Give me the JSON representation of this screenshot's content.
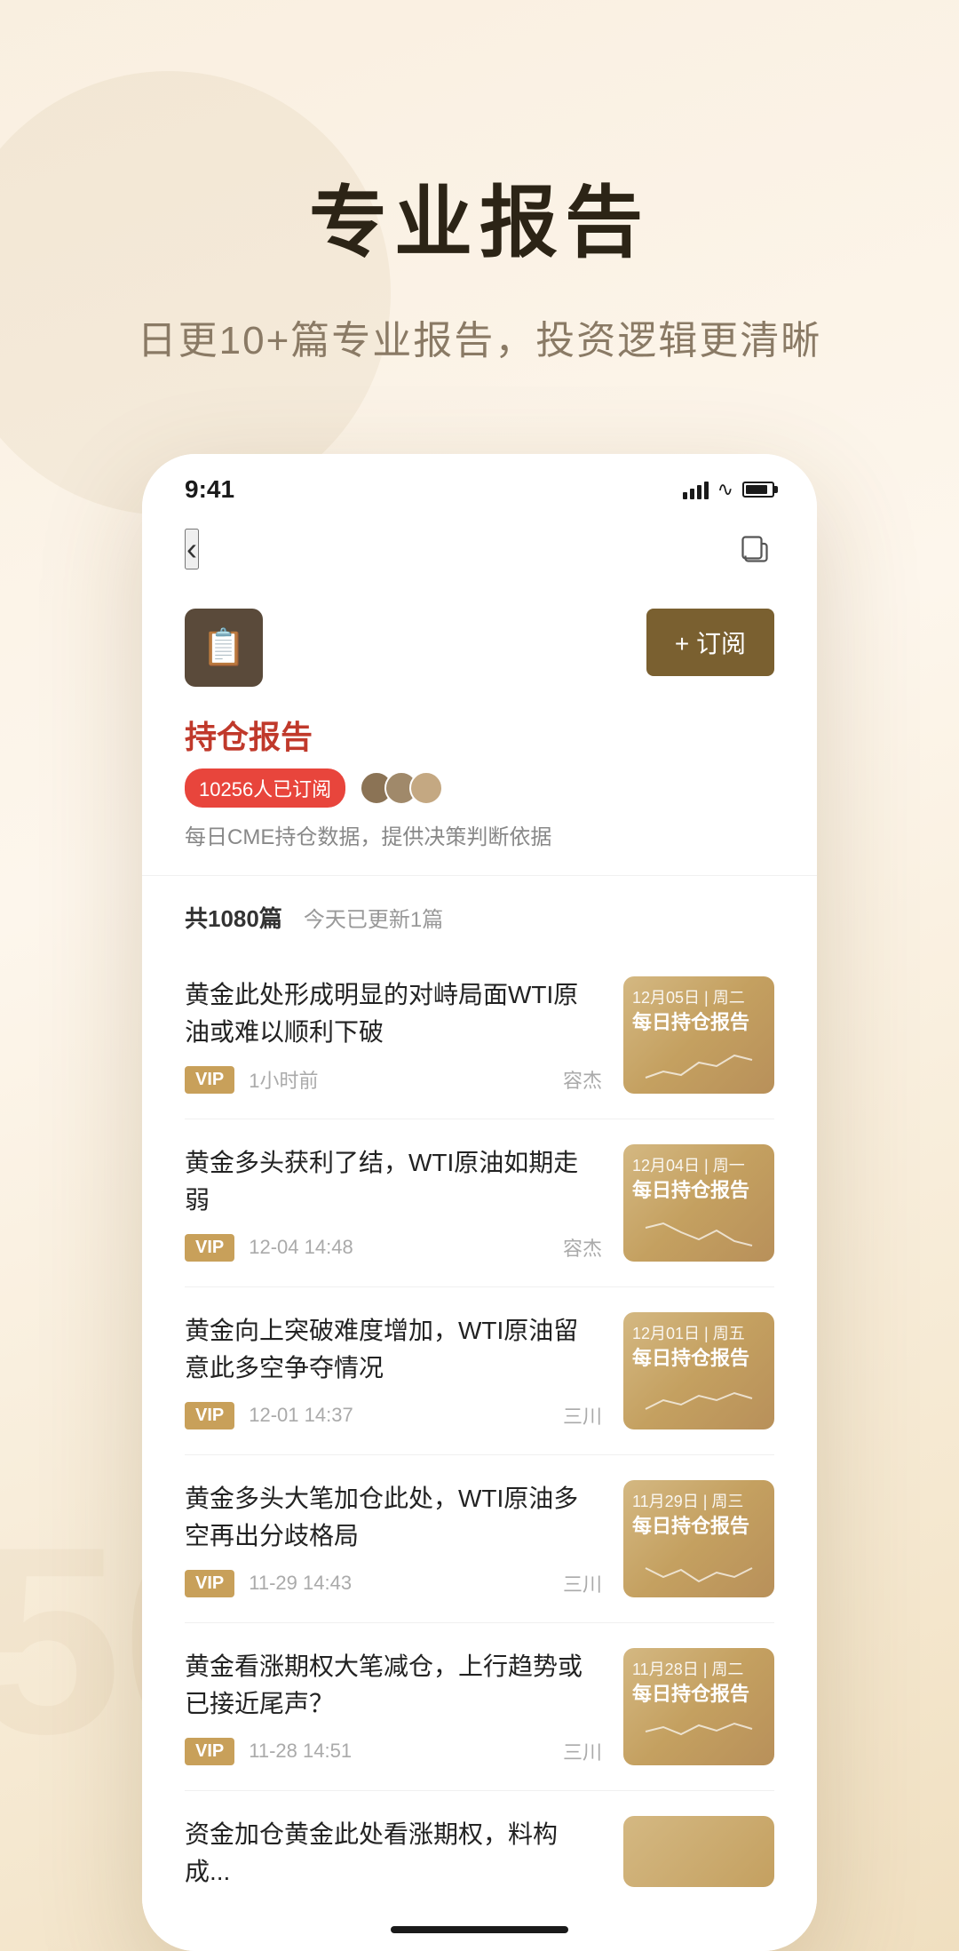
{
  "hero": {
    "title": "专业报告",
    "subtitle": "日更10+篇专业报告，投资逻辑更清晰"
  },
  "status_bar": {
    "time": "9:41",
    "signal": "signal",
    "wifi": "wifi",
    "battery": "battery"
  },
  "nav": {
    "back_label": "‹",
    "share_label": "share"
  },
  "channel": {
    "name": "持仓报告",
    "desc": "每日CME持仓数据，提供决策判断依据",
    "subscriber_count": "10256人已订阅",
    "subscribe_btn": "+ 订阅",
    "article_count": "共1080篇",
    "today_update": "今天已更新1篇"
  },
  "articles": [
    {
      "title": "黄金此处形成明显的对峙局面WTI原油或难以顺利下破",
      "vip": "VIP",
      "time": "1小时前",
      "author": "容杰",
      "thumb_date": "12月05日 | 周二",
      "thumb_title": "每日持仓报告"
    },
    {
      "title": "黄金多头获利了结，WTI原油如期走弱",
      "vip": "VIP",
      "time": "12-04 14:48",
      "author": "容杰",
      "thumb_date": "12月04日 | 周一",
      "thumb_title": "每日持仓报告"
    },
    {
      "title": "黄金向上突破难度增加，WTI原油留意此多空争夺情况",
      "vip": "VIP",
      "time": "12-01 14:37",
      "author": "三川",
      "thumb_date": "12月01日 | 周五",
      "thumb_title": "每日持仓报告"
    },
    {
      "title": "黄金多头大笔加仓此处，WTI原油多空再出分歧格局",
      "vip": "VIP",
      "time": "11-29 14:43",
      "author": "三川",
      "thumb_date": "11月29日 | 周三",
      "thumb_title": "每日持仓报告"
    },
    {
      "title": "黄金看涨期权大笔减仓，上行趋势或已接近尾声？",
      "vip": "VIP",
      "time": "11-28 14:51",
      "author": "三川",
      "thumb_date": "11月28日 | 周二",
      "thumb_title": "每日持仓报告"
    }
  ],
  "partial_article": {
    "title": "资金加仓黄金此处看涨期权，料构成..."
  },
  "colors": {
    "accent": "#7a6030",
    "name_red": "#c0392b",
    "badge_red": "#e8453c",
    "vip_gold": "#c8a05a"
  }
}
